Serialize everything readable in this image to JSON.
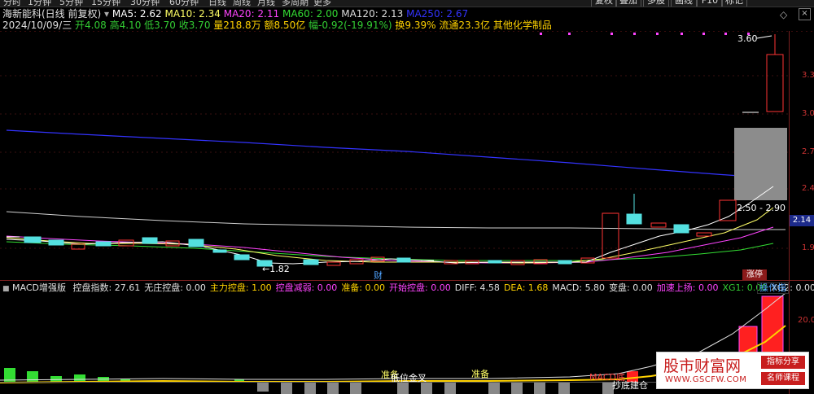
{
  "toolbar": {
    "left_items": [
      "分时",
      "1分钟",
      "5分钟",
      "15分钟",
      "30分钟",
      "60分钟",
      "日线",
      "周线",
      "月线",
      "多周期",
      "更多"
    ],
    "right_buttons": [
      "复权",
      "叠加",
      "多股",
      "画线",
      "F10",
      "标记"
    ]
  },
  "header": {
    "title": "海新能科(日线 前复权)",
    "ma5": "MA5: 2.62",
    "ma10": "MA10: 2.34",
    "ma20": "MA20: 2.11",
    "ma60": "MA60: 2.00",
    "ma120": "MA120: 2.13",
    "ma250": "MA250: 2.67"
  },
  "quote": {
    "date": "2024/10/09/三",
    "open": "开4.08",
    "high": "高4.10",
    "low": "低3.70",
    "close": "收3.70",
    "volume": "量218.8万",
    "amount": "额8.50亿",
    "change": "幅-0.92(-19.91%)",
    "turnover": "换9.39%",
    "float": "流通23.3亿",
    "sector": "其他化学制品"
  },
  "price_axis": [
    "3.3",
    "3.0",
    "2.7",
    "2.4",
    "1.9"
  ],
  "current_price_tag": "2.14",
  "annotations": {
    "high_label": "3.60",
    "range_label": "2.50 - 2.90",
    "low_label": "1.82",
    "cai_marker": "财",
    "limit_up": "涨停"
  },
  "indicator": {
    "name": "MACD增强版",
    "items": [
      {
        "text": "控盘指数: 27.61",
        "color": "#e0e0e0"
      },
      {
        "text": "无庄控盘: 0.00",
        "color": "#e0e0e0"
      },
      {
        "text": "主力控盘: 1.00",
        "color": "#ffd200"
      },
      {
        "text": "控盘减弱: 0.00",
        "color": "#ff44ff"
      },
      {
        "text": "准备: 0.00",
        "color": "#ffd200"
      },
      {
        "text": "开始控盘: 0.00",
        "color": "#ff44ff"
      },
      {
        "text": "DIFF: 4.58",
        "color": "#e0e0e0"
      },
      {
        "text": "DEA: 1.68",
        "color": "#ffd200"
      },
      {
        "text": "MACD: 5.80",
        "color": "#e0e0e0"
      },
      {
        "text": "变盘: 0.00",
        "color": "#e0e0e0"
      },
      {
        "text": "加速上扬: 0.00",
        "color": "#ff44ff"
      },
      {
        "text": "XG1: 0.00",
        "color": "#33cc33"
      },
      {
        "text": "XG2: 0.00",
        "color": "#e0e0e0"
      }
    ],
    "button": "操作指",
    "axis_label": "20.0",
    "signals": [
      "准备",
      "低位金叉",
      "准备",
      "MACD底",
      "抄底建仓"
    ]
  },
  "watermark": {
    "title": "股市财富网",
    "url": "WWW.GSCFW.COM",
    "tag1": "指标分享",
    "tag2": "名师课程"
  },
  "colors": {
    "up": "#ff3333",
    "down": "#33cccc",
    "ma5": "#ffffff",
    "ma10": "#ffff66",
    "ma20": "#ff44ff",
    "ma60": "#33dd33",
    "ma120": "#dddddd",
    "ma250": "#3333ff"
  }
}
